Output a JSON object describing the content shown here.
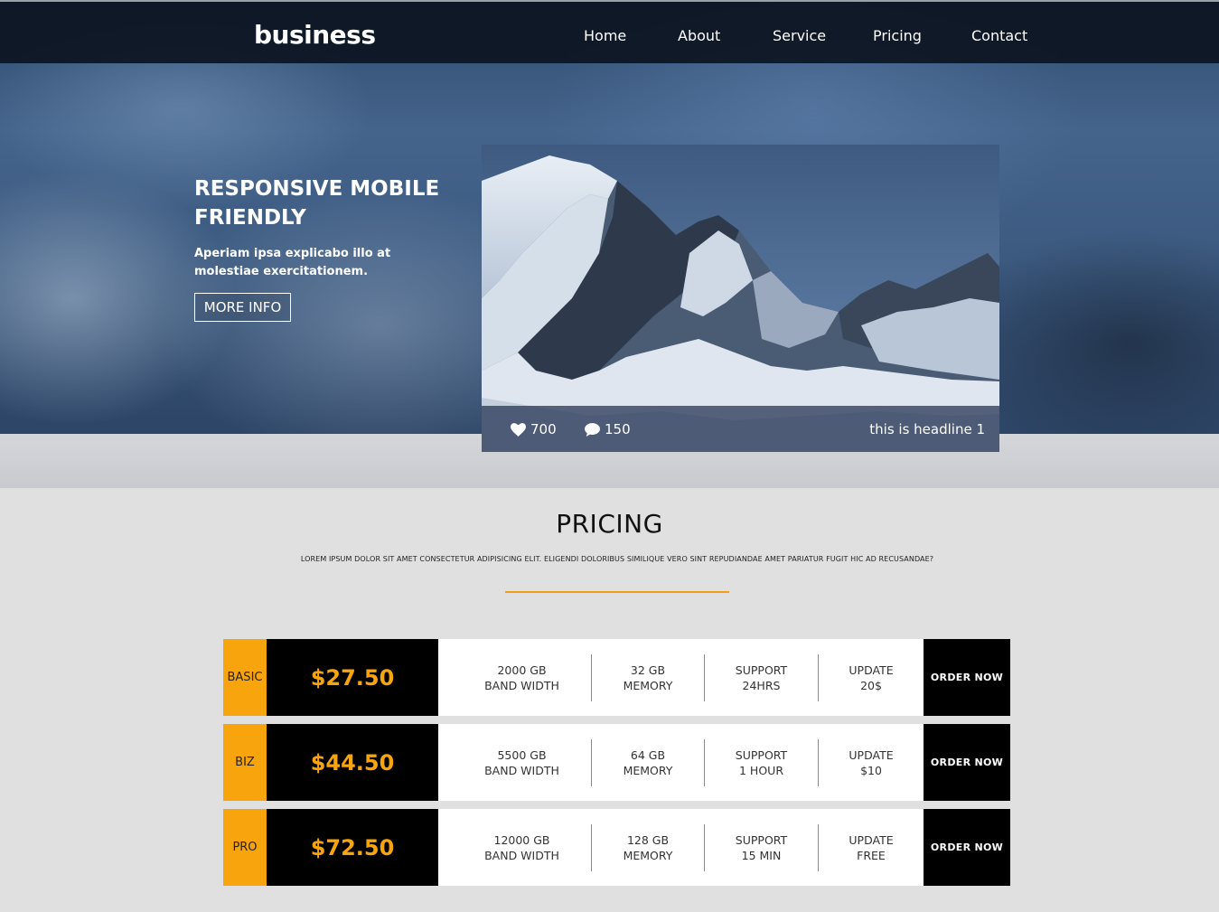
{
  "nav": {
    "brand": "business",
    "links": [
      "Home",
      "About",
      "Service",
      "Pricing",
      "Contact"
    ]
  },
  "hero": {
    "title": "RESPONSIVE MOBILE FRIENDLY",
    "subtitle": "Aperiam ipsa explicabo illo at molestiae exercitationem.",
    "button": "MORE INFO",
    "card": {
      "likes": "700",
      "comments": "150",
      "headline": "this is headline 1"
    }
  },
  "pricing": {
    "title": "PRICING",
    "description": "LOREM IPSUM DOLOR SIT AMET CONSECTETUR ADIPISICING ELIT. ELIGENDI DOLORIBUS SIMILIQUE VERO SINT REPUDIANDAE AMET PARIATUR FUGIT HIC AD RECUSANDAE?",
    "accent_color": "#f8a40c",
    "plans": [
      {
        "name": "BASIC",
        "price": "$27.50",
        "features": [
          [
            "2000 GB",
            "BAND WIDTH"
          ],
          [
            "32 GB",
            "MEMORY"
          ],
          [
            "SUPPORT",
            "24HRS"
          ],
          [
            "UPDATE",
            "20$"
          ]
        ],
        "button": "ORDER NOW"
      },
      {
        "name": "BIZ",
        "price": "$44.50",
        "features": [
          [
            "5500 GB",
            "BAND WIDTH"
          ],
          [
            "64 GB",
            "MEMORY"
          ],
          [
            "SUPPORT",
            "1 HOUR"
          ],
          [
            "UPDATE",
            "$10"
          ]
        ],
        "button": "ORDER NOW"
      },
      {
        "name": "PRO",
        "price": "$72.50",
        "features": [
          [
            "12000 GB",
            "BAND WIDTH"
          ],
          [
            "128 GB",
            "MEMORY"
          ],
          [
            "SUPPORT",
            "15 MIN"
          ],
          [
            "UPDATE",
            "FREE"
          ]
        ],
        "button": "ORDER NOW"
      }
    ]
  }
}
